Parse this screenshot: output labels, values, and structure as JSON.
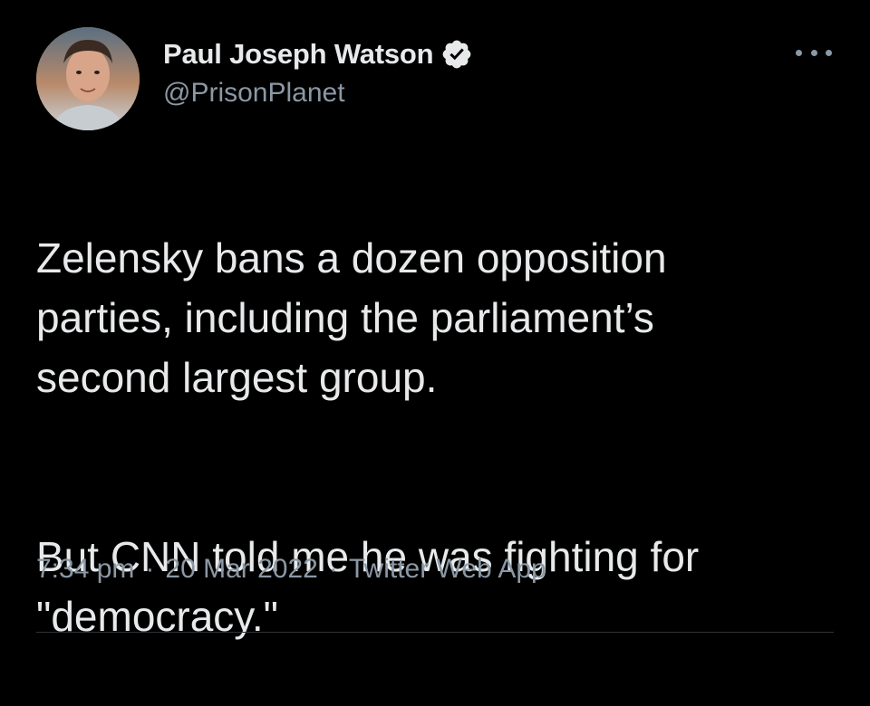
{
  "author": {
    "display_name": "Paul Joseph Watson",
    "handle": "@PrisonPlanet",
    "verified": true,
    "avatar_icon": "profile-photo",
    "verified_icon": "verified-badge-icon"
  },
  "tweet": {
    "paragraphs": [
      "Zelensky bans a dozen opposition\nparties, including the parliament’s\nsecond largest group.",
      "But CNN told me he was fighting for\n\"democracy.\""
    ]
  },
  "meta": {
    "time": "7:34 pm",
    "date": "20 Mar 2022",
    "source": "Twitter Web App",
    "separator": "·"
  },
  "menu": {
    "icon": "more-options-icon"
  },
  "colors": {
    "background": "#000000",
    "primary_text": "#e7e9ea",
    "secondary_text": "#8b98a5",
    "verified_badge": "#e7e9ea",
    "divider": "#2f3336"
  }
}
